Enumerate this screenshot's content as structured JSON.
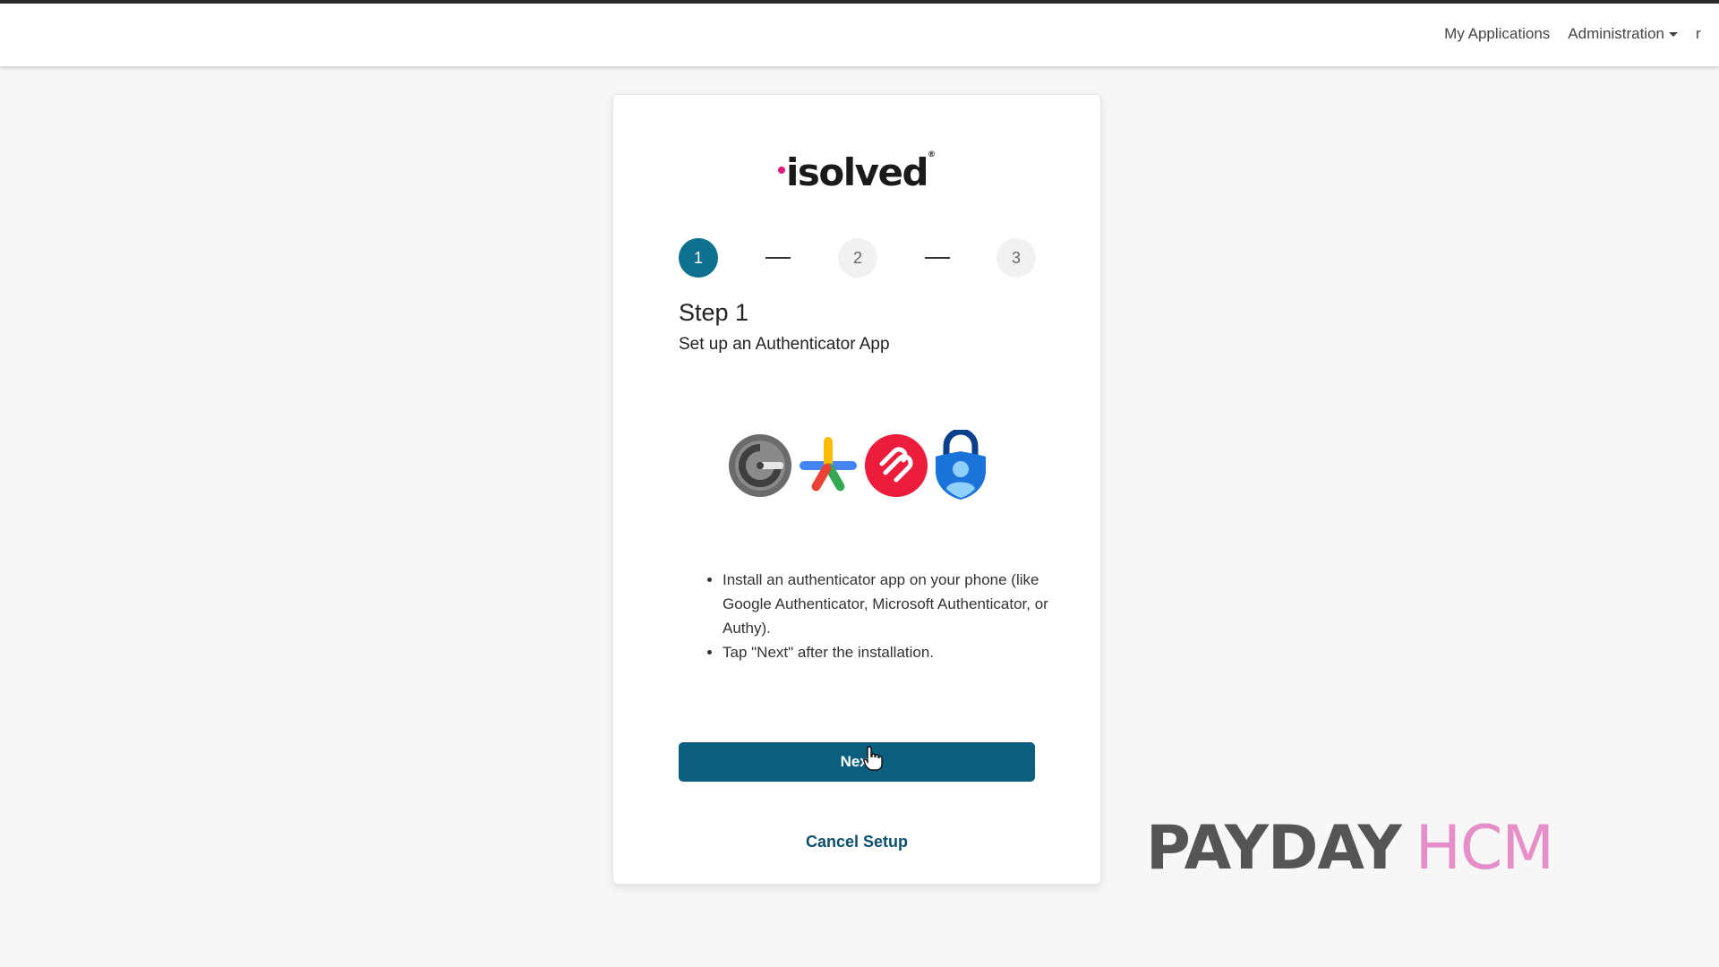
{
  "nav": {
    "my_applications": "My Applications",
    "administration": "Administration",
    "cut_item": "r"
  },
  "brand": {
    "logo_text": "isolved",
    "accent": "#e0197d"
  },
  "stepper": {
    "steps": [
      "1",
      "2",
      "3"
    ],
    "current": 1,
    "active_color": "#0f6f8e"
  },
  "content": {
    "title": "Step 1",
    "subtitle": "Set up an Authenticator App",
    "app_icons": [
      "google-authenticator-icon",
      "google-multicolor-icon",
      "authy-icon",
      "microsoft-authenticator-icon"
    ],
    "instructions": [
      "Install an authenticator app on your phone (like Google Authenticator, Microsoft Authenticator, or Authy).",
      "Tap \"Next\" after the installation."
    ]
  },
  "actions": {
    "next_label": "Next",
    "cancel_label": "Cancel Setup",
    "button_color": "#0b5e7e"
  },
  "watermark": {
    "part1": "PAYDAY",
    "part2": "HCM"
  }
}
